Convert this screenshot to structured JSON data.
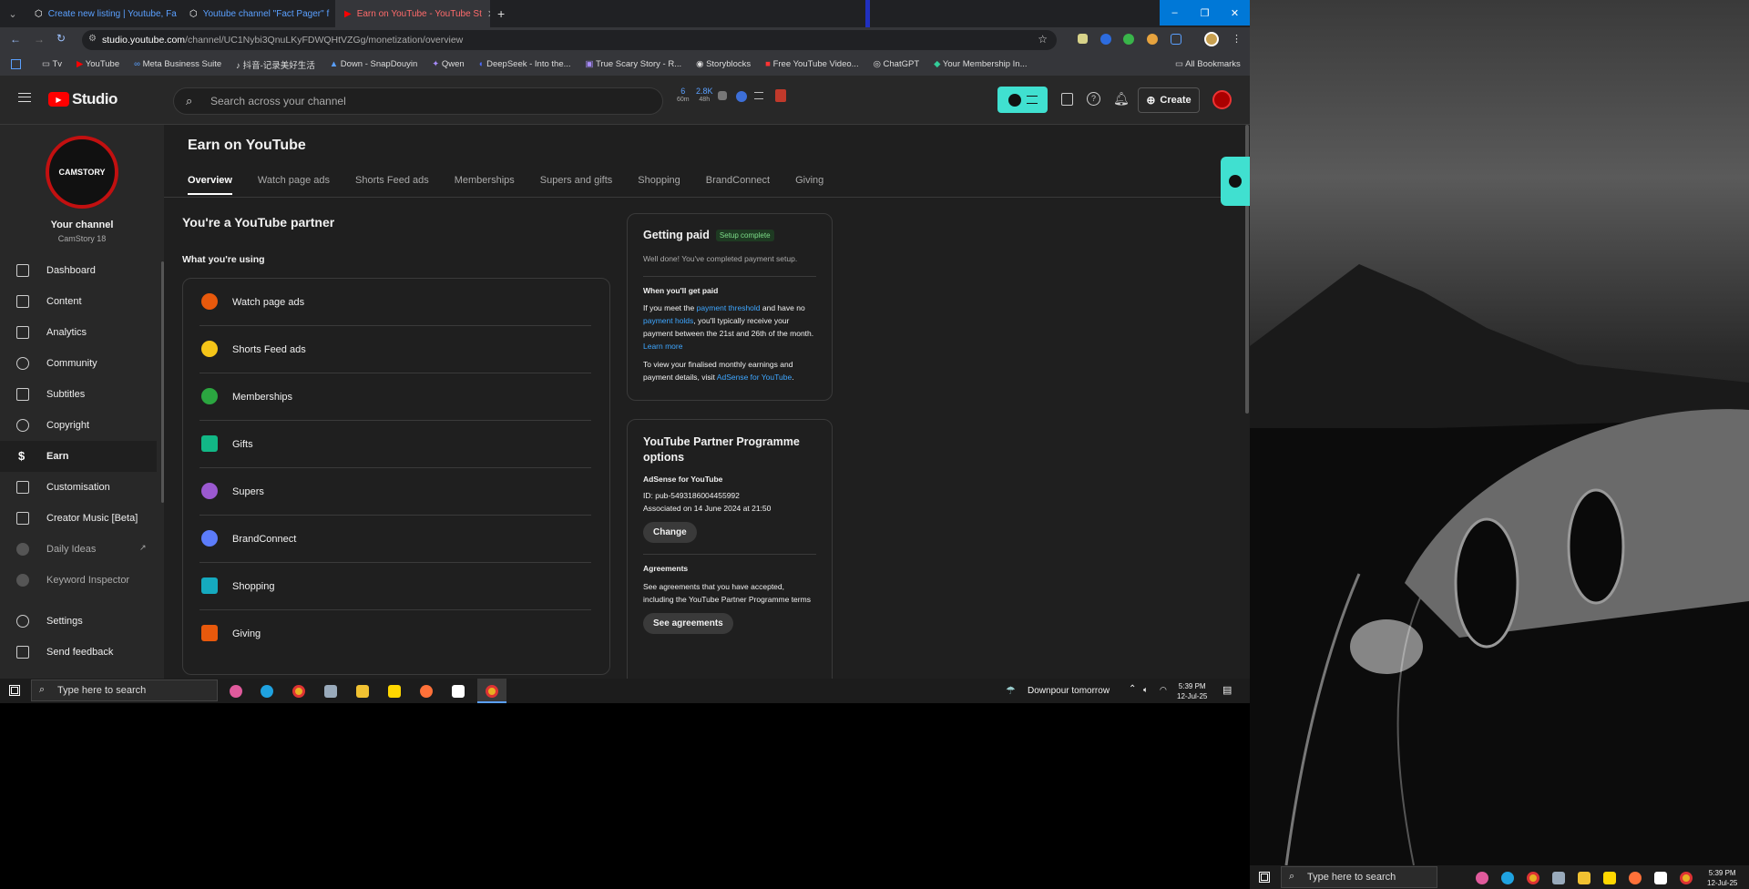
{
  "browser": {
    "tabs": [
      {
        "title": "Create new listing | Youtube, Fa"
      },
      {
        "title": "Youtube channel \"Fact Pager\" f"
      },
      {
        "title": "Earn on YouTube - YouTube St"
      }
    ],
    "new_tab": "+",
    "url_host": "studio.youtube.com",
    "url_path": "/channel/UC1Nybi3QnuLKyFDWQHtVZGg/monetization/overview",
    "bookmarks": [
      "Tv",
      "YouTube",
      "Meta Business Suite",
      "抖音-记录美好生活",
      "Down - SnapDouyin",
      "Qwen",
      "DeepSeek - Into the...",
      "True Scary Story - R...",
      "Storyblocks",
      "Free YouTube Video...",
      "ChatGPT",
      "Your Membership In..."
    ],
    "all_bookmarks": "All Bookmarks",
    "win_minimize": "–",
    "win_restore": "❐",
    "win_close": "✕"
  },
  "header": {
    "logo_text": "Studio",
    "search_placeholder": "Search across your channel",
    "stat1_value": "6",
    "stat1_sub": "60m",
    "stat2_value": "2.8K",
    "stat2_sub": "48h",
    "create_label": "Create"
  },
  "sidebar": {
    "channel_label": "Your channel",
    "channel_name": "CamStory 18",
    "avatar_text": "CAMSTORY",
    "items": [
      {
        "label": "Dashboard"
      },
      {
        "label": "Content"
      },
      {
        "label": "Analytics"
      },
      {
        "label": "Community"
      },
      {
        "label": "Subtitles"
      },
      {
        "label": "Copyright"
      },
      {
        "label": "Earn"
      },
      {
        "label": "Customisation"
      },
      {
        "label": "Creator Music [Beta]"
      },
      {
        "label": "Daily Ideas"
      },
      {
        "label": "Keyword Inspector"
      }
    ],
    "settings": "Settings",
    "feedback": "Send feedback"
  },
  "page": {
    "title": "Earn on YouTube",
    "tabs": [
      "Overview",
      "Watch page ads",
      "Shorts Feed ads",
      "Memberships",
      "Supers and gifts",
      "Shopping",
      "BrandConnect",
      "Giving"
    ],
    "partner_heading": "You're a YouTube partner",
    "using_heading": "What you're using",
    "features": [
      "Watch page ads",
      "Shorts Feed ads",
      "Memberships",
      "Gifts",
      "Supers",
      "BrandConnect",
      "Shopping",
      "Giving"
    ]
  },
  "getting_paid": {
    "title": "Getting paid",
    "badge": "Setup complete",
    "done_text": "Well done! You've completed payment setup.",
    "when_heading": "When you'll get paid",
    "p1_a": "If you meet the ",
    "p1_link1": "payment threshold",
    "p1_b": " and have no ",
    "p1_link2": "payment holds",
    "p1_c": ", you'll typically receive your payment between the 21st and 26th of the month. ",
    "p1_link3": "Learn more",
    "p2_a": "To view your finalised monthly earnings and payment details, visit ",
    "p2_link": "AdSense for YouTube",
    "p2_b": "."
  },
  "ypp": {
    "title": "YouTube Partner Programme options",
    "adsense_heading": "AdSense for YouTube",
    "id_text": "ID: pub-5493186004455992",
    "assoc_text": "Associated on 14 June 2024 at 21:50",
    "change_label": "Change",
    "agreements_heading": "Agreements",
    "agreements_text": "See agreements that you have accepted, including the YouTube Partner Programme terms",
    "see_agreements_label": "See agreements"
  },
  "taskbar": {
    "search_placeholder": "Type here to search",
    "weather": "Downpour tomorrow",
    "time": "5:39 PM",
    "date": "12-Jul-25"
  },
  "taskbar2": {
    "search_placeholder": "Type here to search",
    "time": "5:39 PM",
    "date": "12-Jul-25"
  },
  "colors": {
    "accent_teal": "#40e0d0",
    "youtube_red": "#ff0000",
    "link_blue": "#3ea6ff",
    "badge_green": "#2ba640"
  }
}
